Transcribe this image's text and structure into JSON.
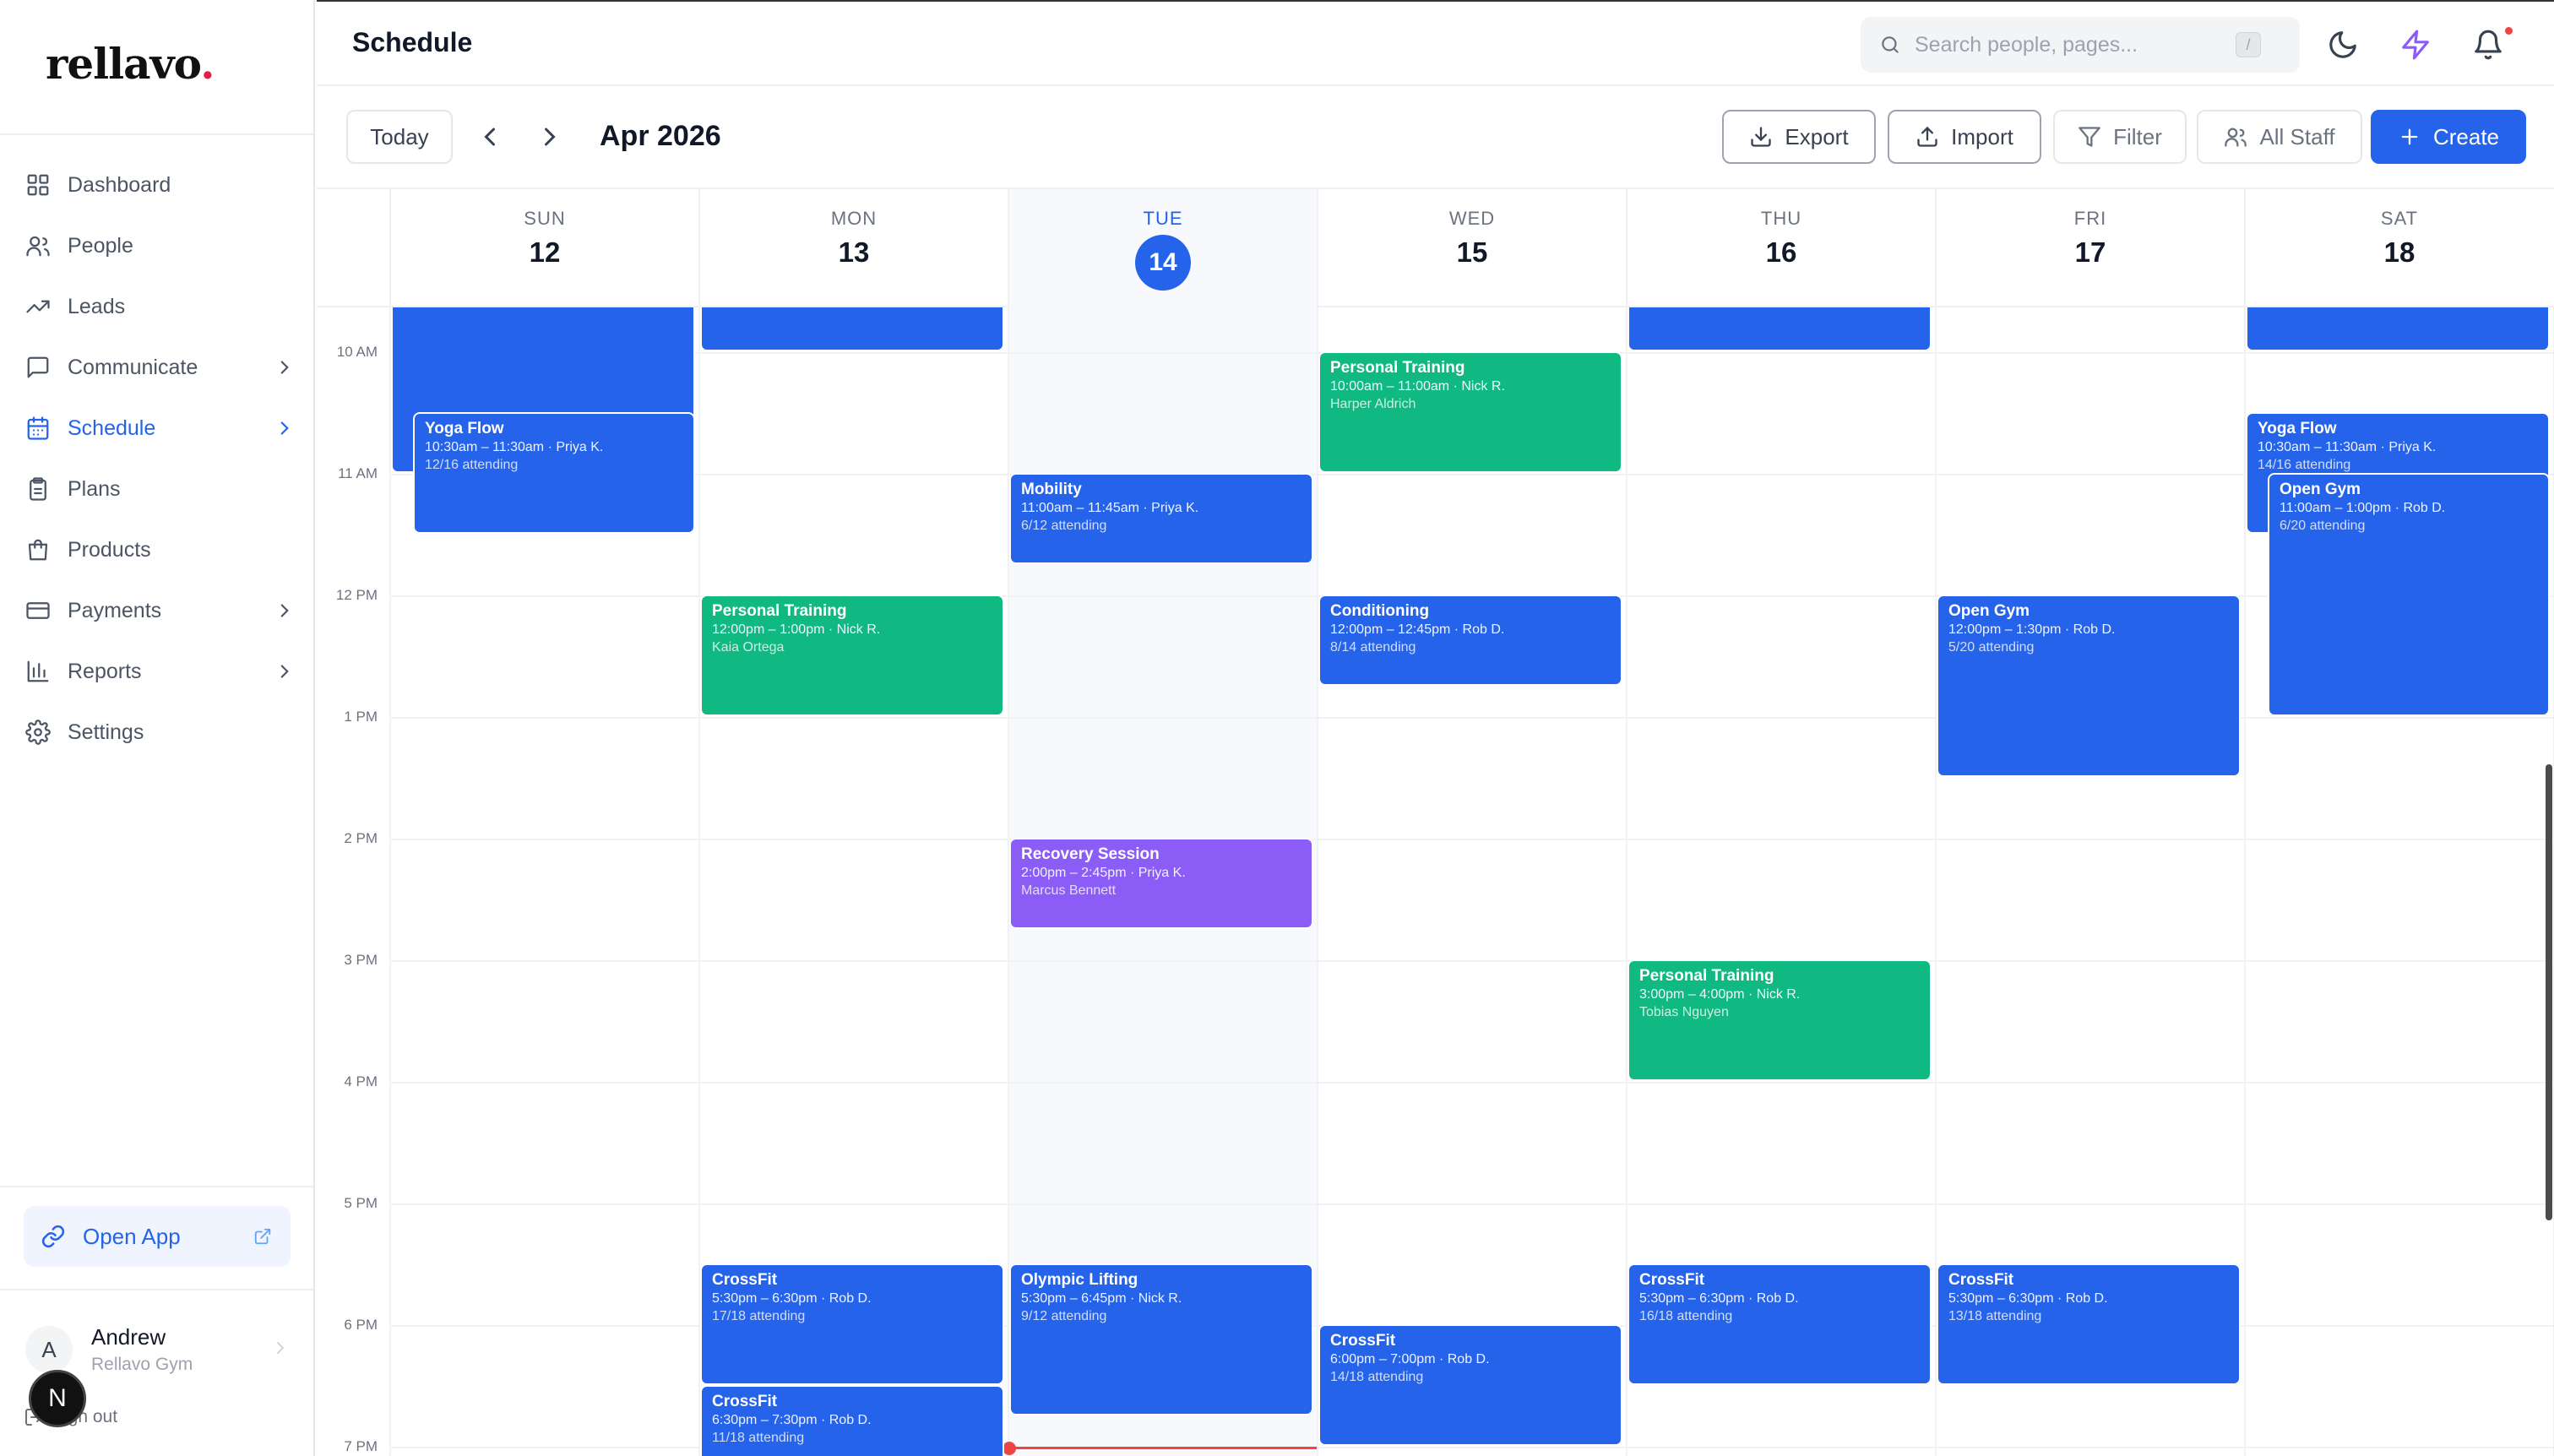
{
  "app": {
    "brand": "rellavo",
    "brand_dot": "."
  },
  "sidebar": {
    "items": [
      {
        "label": "Dashboard",
        "icon": "grid-icon",
        "active": false,
        "has_chevron": false
      },
      {
        "label": "People",
        "icon": "users-icon",
        "active": false,
        "has_chevron": false
      },
      {
        "label": "Leads",
        "icon": "trending-up-icon",
        "active": false,
        "has_chevron": false
      },
      {
        "label": "Communicate",
        "icon": "message-icon",
        "active": false,
        "has_chevron": true
      },
      {
        "label": "Schedule",
        "icon": "calendar-icon",
        "active": true,
        "has_chevron": true
      },
      {
        "label": "Plans",
        "icon": "clipboard-icon",
        "active": false,
        "has_chevron": false
      },
      {
        "label": "Products",
        "icon": "bag-icon",
        "active": false,
        "has_chevron": false
      },
      {
        "label": "Payments",
        "icon": "card-icon",
        "active": false,
        "has_chevron": true
      },
      {
        "label": "Reports",
        "icon": "bar-chart-icon",
        "active": false,
        "has_chevron": true
      },
      {
        "label": "Settings",
        "icon": "gear-icon",
        "active": false,
        "has_chevron": false
      }
    ],
    "open_app_label": "Open App",
    "user": {
      "initial": "A",
      "name": "Andrew",
      "gym": "Rellavo Gym"
    },
    "signout_label": "Sign out",
    "badge_letter": "N"
  },
  "header": {
    "title": "Schedule",
    "search_placeholder": "Search people, pages...",
    "search_shortcut": "/"
  },
  "toolbar": {
    "today_label": "Today",
    "month": "Apr 2026",
    "export_label": "Export",
    "import_label": "Import",
    "filter_label": "Filter",
    "staff_label": "All Staff",
    "create_label": "Create"
  },
  "calendar": {
    "days": [
      {
        "dow": "SUN",
        "num": "12",
        "today": false
      },
      {
        "dow": "MON",
        "num": "13",
        "today": false
      },
      {
        "dow": "TUE",
        "num": "14",
        "today": true
      },
      {
        "dow": "WED",
        "num": "15",
        "today": false
      },
      {
        "dow": "THU",
        "num": "16",
        "today": false
      },
      {
        "dow": "FRI",
        "num": "17",
        "today": false
      },
      {
        "dow": "SAT",
        "num": "18",
        "today": false
      }
    ],
    "hours": [
      "10 AM",
      "11 AM",
      "12 PM",
      "1 PM",
      "2 PM",
      "3 PM",
      "4 PM",
      "5 PM",
      "6 PM",
      "7 PM"
    ],
    "view_start_hour": 9.63,
    "now_time": 19.0,
    "colors": {
      "blue": "#2563eb",
      "green": "#10b981",
      "purple": "#8b5cf6"
    },
    "events": [
      {
        "day": 0,
        "start": 9.0,
        "end": 11.0,
        "color": "blue",
        "title": "",
        "time": "",
        "sub": ""
      },
      {
        "day": 0,
        "start": 10.5,
        "end": 11.5,
        "color": "blue",
        "title": "Yoga Flow",
        "time": "10:30am – 11:30am · Priya K.",
        "sub": "12/16 attending",
        "lane": 1
      },
      {
        "day": 1,
        "start": 9.0,
        "end": 10.0,
        "color": "blue",
        "title": "",
        "time": "",
        "sub": ""
      },
      {
        "day": 1,
        "start": 12.0,
        "end": 13.0,
        "color": "green",
        "title": "Personal Training",
        "time": "12:00pm – 1:00pm · Nick R.",
        "sub": "Kaia Ortega"
      },
      {
        "day": 1,
        "start": 17.5,
        "end": 18.5,
        "color": "blue",
        "title": "CrossFit",
        "time": "5:30pm – 6:30pm · Rob D.",
        "sub": "17/18 attending"
      },
      {
        "day": 1,
        "start": 18.5,
        "end": 19.5,
        "color": "blue",
        "title": "CrossFit",
        "time": "6:30pm – 7:30pm · Rob D.",
        "sub": "11/18 attending"
      },
      {
        "day": 2,
        "start": 11.0,
        "end": 11.75,
        "color": "blue",
        "title": "Mobility",
        "time": "11:00am – 11:45am · Priya K.",
        "sub": "6/12 attending"
      },
      {
        "day": 2,
        "start": 14.0,
        "end": 14.75,
        "color": "purple",
        "title": "Recovery Session",
        "time": "2:00pm – 2:45pm · Priya K.",
        "sub": "Marcus Bennett"
      },
      {
        "day": 2,
        "start": 17.5,
        "end": 18.75,
        "color": "blue",
        "title": "Olympic Lifting",
        "time": "5:30pm – 6:45pm · Nick R.",
        "sub": "9/12 attending"
      },
      {
        "day": 3,
        "start": 10.0,
        "end": 11.0,
        "color": "green",
        "title": "Personal Training",
        "time": "10:00am – 11:00am · Nick R.",
        "sub": "Harper Aldrich"
      },
      {
        "day": 3,
        "start": 12.0,
        "end": 12.75,
        "color": "blue",
        "title": "Conditioning",
        "time": "12:00pm – 12:45pm · Rob D.",
        "sub": "8/14 attending"
      },
      {
        "day": 3,
        "start": 18.0,
        "end": 19.0,
        "color": "blue",
        "title": "CrossFit",
        "time": "6:00pm – 7:00pm · Rob D.",
        "sub": "14/18 attending"
      },
      {
        "day": 4,
        "start": 9.0,
        "end": 10.0,
        "color": "blue",
        "title": "",
        "time": "",
        "sub": ""
      },
      {
        "day": 4,
        "start": 15.0,
        "end": 16.0,
        "color": "green",
        "title": "Personal Training",
        "time": "3:00pm – 4:00pm · Nick R.",
        "sub": "Tobias Nguyen"
      },
      {
        "day": 4,
        "start": 17.5,
        "end": 18.5,
        "color": "blue",
        "title": "CrossFit",
        "time": "5:30pm – 6:30pm · Rob D.",
        "sub": "16/18 attending"
      },
      {
        "day": 5,
        "start": 12.0,
        "end": 13.5,
        "color": "blue",
        "title": "Open Gym",
        "time": "12:00pm – 1:30pm · Rob D.",
        "sub": "5/20 attending"
      },
      {
        "day": 5,
        "start": 17.5,
        "end": 18.5,
        "color": "blue",
        "title": "CrossFit",
        "time": "5:30pm – 6:30pm · Rob D.",
        "sub": "13/18 attending"
      },
      {
        "day": 6,
        "start": 9.0,
        "end": 10.0,
        "color": "blue",
        "title": "",
        "time": "",
        "sub": ""
      },
      {
        "day": 6,
        "start": 10.5,
        "end": 11.5,
        "color": "blue",
        "title": "Yoga Flow",
        "time": "10:30am – 11:30am · Priya K.",
        "sub": "14/16 attending"
      },
      {
        "day": 6,
        "start": 11.0,
        "end": 13.0,
        "color": "blue",
        "title": "Open Gym",
        "time": "11:00am – 1:00pm · Rob D.",
        "sub": "6/20 attending",
        "lane": 1
      }
    ]
  }
}
